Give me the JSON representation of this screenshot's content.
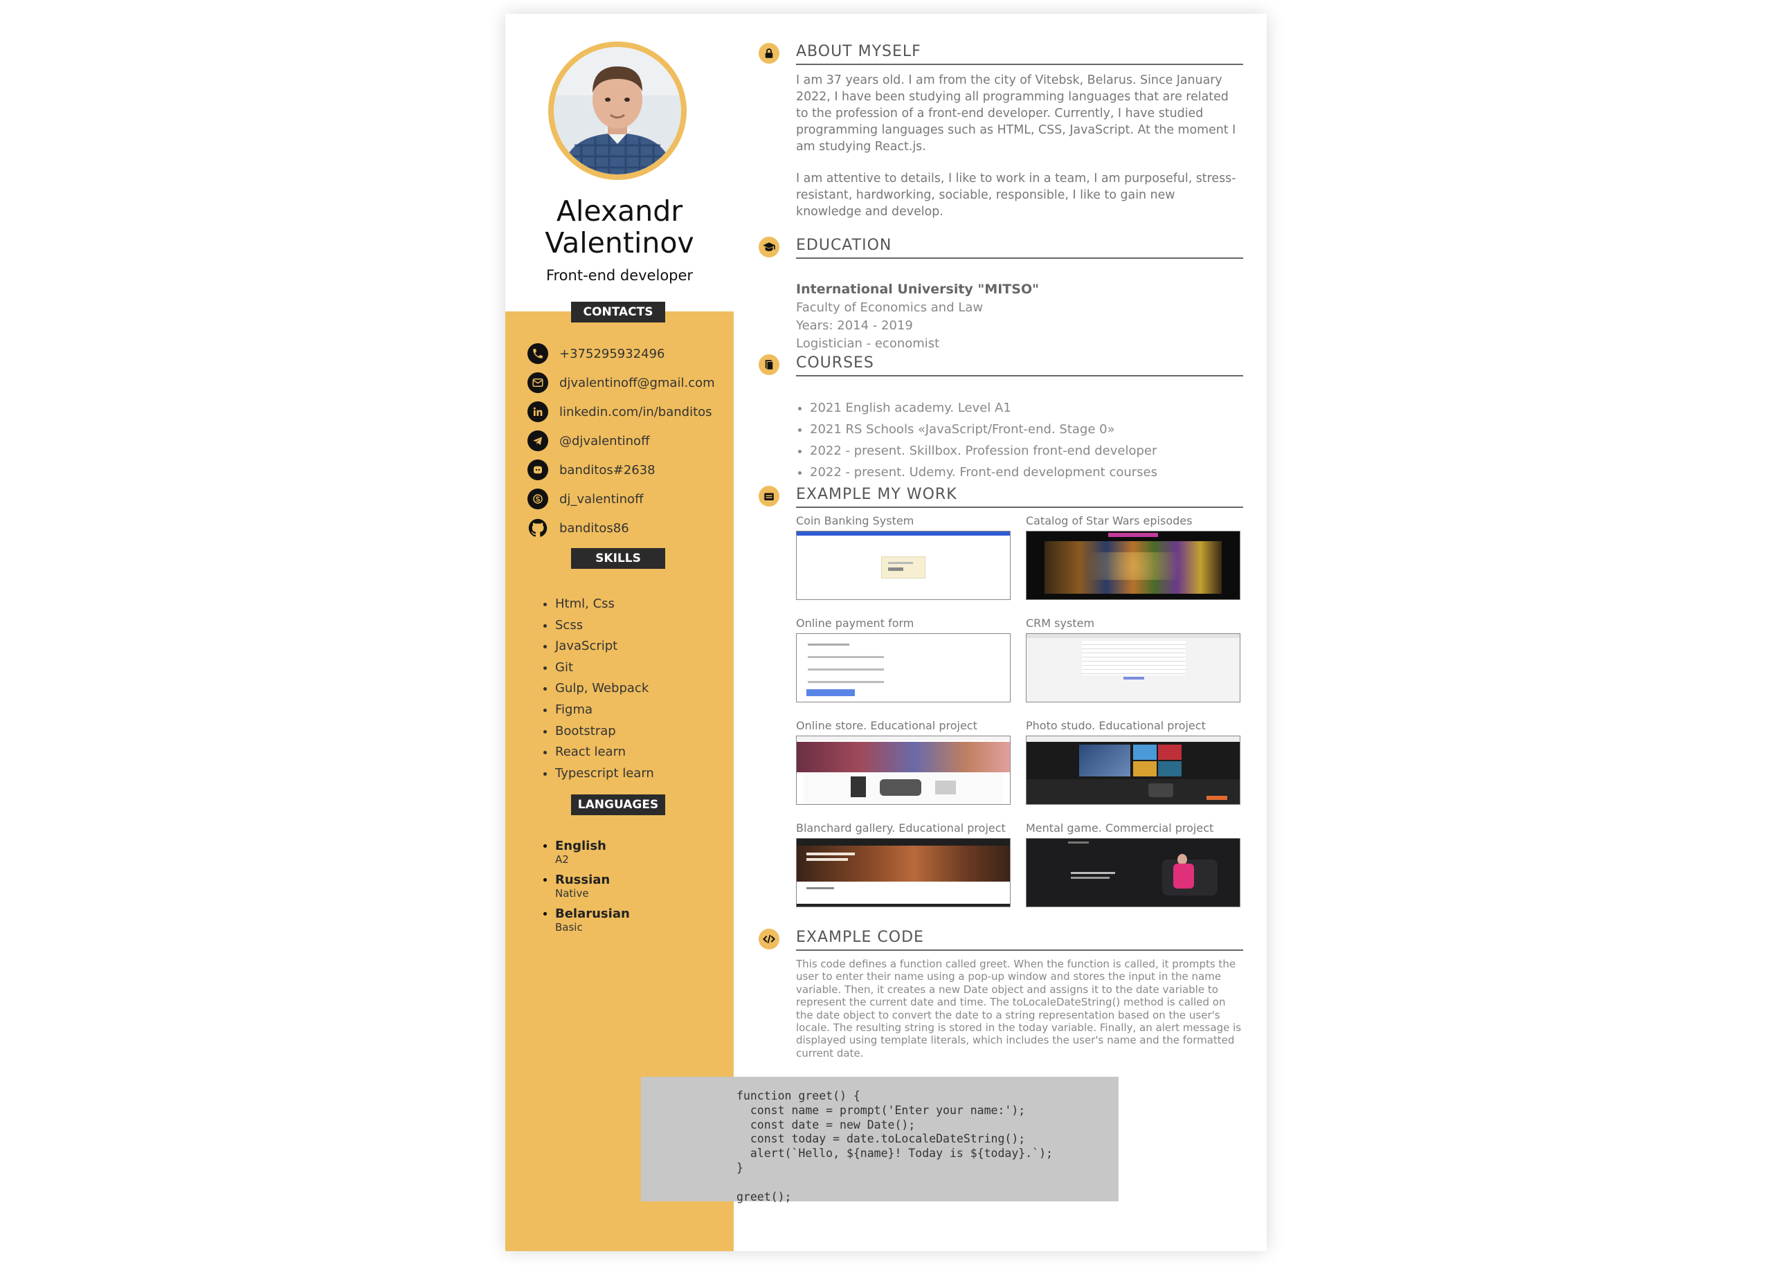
{
  "profile": {
    "first_name": "Alexandr",
    "last_name": "Valentinov",
    "role": "Front-end developer",
    "photo_alt": "portrait photo"
  },
  "sidebar": {
    "contacts_heading": "CONTACTS",
    "contacts": [
      {
        "icon": "phone-icon",
        "text": "+375295932496"
      },
      {
        "icon": "email-icon",
        "text": "djvalentinoff@gmail.com"
      },
      {
        "icon": "linkedin-icon",
        "text": "linkedin.com/in/banditos"
      },
      {
        "icon": "telegram-icon",
        "text": "@djvalentinoff"
      },
      {
        "icon": "discord-icon",
        "text": "banditos#2638"
      },
      {
        "icon": "skype-icon",
        "text": "dj_valentinoff"
      },
      {
        "icon": "github-icon",
        "text": "banditos86"
      }
    ],
    "skills_heading": "SKILLS",
    "skills": [
      "Html, Css",
      "Scss",
      "JavaScript",
      "Git",
      "Gulp, Webpack",
      "Figma",
      "Bootstrap",
      "React learn",
      "Typescript learn"
    ],
    "languages_heading": "LANGUAGES",
    "languages": [
      {
        "name": "English",
        "level": "A2"
      },
      {
        "name": "Russian",
        "level": "Native"
      },
      {
        "name": "Belarusian",
        "level": "Basic"
      }
    ]
  },
  "about": {
    "title": "ABOUT MYSELF",
    "p1": "I am 37 years old. I am from the city of Vitebsk, Belarus. Since January 2022, I have been studying all programming languages that are related to the profession of a front-end developer. Currently, I have studied programming languages such as HTML, CSS, JavaScript. At the moment I am studying React.js.",
    "p2": "I am attentive to details, I like to work in a team, I am purposeful, stress-resistant, hardworking, sociable, responsible, I like to gain new knowledge and develop."
  },
  "education": {
    "title": "EDUCATION",
    "university": "International University \"MITSO\"",
    "faculty": "Faculty of Economics and Law",
    "years": "Years: 2014 - 2019",
    "degree": "Logistician - economist"
  },
  "courses": {
    "title": "COURSES",
    "items": [
      "2021 English academy. Level A1",
      "2021 RS Schools «JavaScript/Front-end. Stage 0»",
      "2022 - present. Skillbox. Profession front-end developer",
      "2022 - present. Udemy. Front-end development courses"
    ]
  },
  "work": {
    "title": "EXAMPLE MY WORK",
    "items": [
      {
        "title": "Coin Banking System"
      },
      {
        "title": "Catalog of Star Wars episodes"
      },
      {
        "title": "Online payment form"
      },
      {
        "title": "CRM system"
      },
      {
        "title": "Online store. Educational project"
      },
      {
        "title": "Photo studo. Educational project"
      },
      {
        "title": "Blanchard gallery. Educational project"
      },
      {
        "title": "Mental game. Commercial project"
      }
    ]
  },
  "code": {
    "title": "EXAMPLE CODE",
    "description": "This code defines a function called greet. When the function is called, it prompts the user to enter their name using a pop-up window and stores the input in the name variable. Then, it creates a new Date object and assigns it to the date variable to represent the current date and time. The toLocaleDateString() method is called on the date object to convert the date to a string representation based on the user's locale. The resulting string is stored in the today variable. Finally, an alert message is displayed using template literals, which includes the user's name and the formatted current date.",
    "snippet": "function greet() {\n  const name = prompt('Enter your name:');\n  const date = new Date();\n  const today = date.toLocaleDateString();\n  alert(`Hello, ${name}! Today is ${today}.`);\n}\n\ngreet();"
  },
  "colors": {
    "accent": "#efbd5d",
    "dark": "#2b2b2b",
    "code_bg": "#c7c7c7"
  }
}
